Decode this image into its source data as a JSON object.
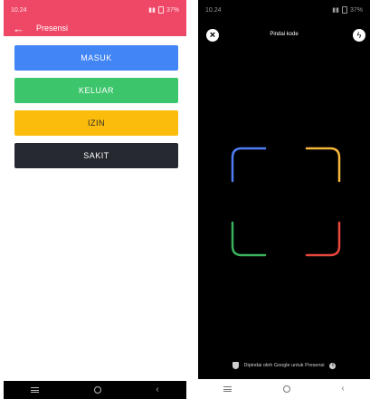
{
  "left": {
    "status": {
      "time": "10.24",
      "battery": "37%"
    },
    "appbar": {
      "title": "Presensi"
    },
    "buttons": {
      "masuk": "MASUK",
      "keluar": "KELUAR",
      "izin": "IZIN",
      "sakit": "SAKIT"
    },
    "colors": {
      "appbar": "#ef4766",
      "masuk": "#4285f4",
      "keluar": "#3cc56b",
      "izin": "#fbbc0b",
      "sakit": "#262a30"
    }
  },
  "right": {
    "status": {
      "time": "10.24",
      "battery": "37%"
    },
    "scanner": {
      "title": "Pindai kode"
    },
    "footer": {
      "text": "Dipindai oleh Google untuk Presensi"
    },
    "icons": [
      "close-icon",
      "flash-icon",
      "shield-icon",
      "info-icon"
    ],
    "frame_colors": {
      "top_left": "#4f7df5",
      "top_right": "#f6b73c",
      "bottom_left": "#3bb25e",
      "bottom_right": "#e8483b"
    }
  }
}
